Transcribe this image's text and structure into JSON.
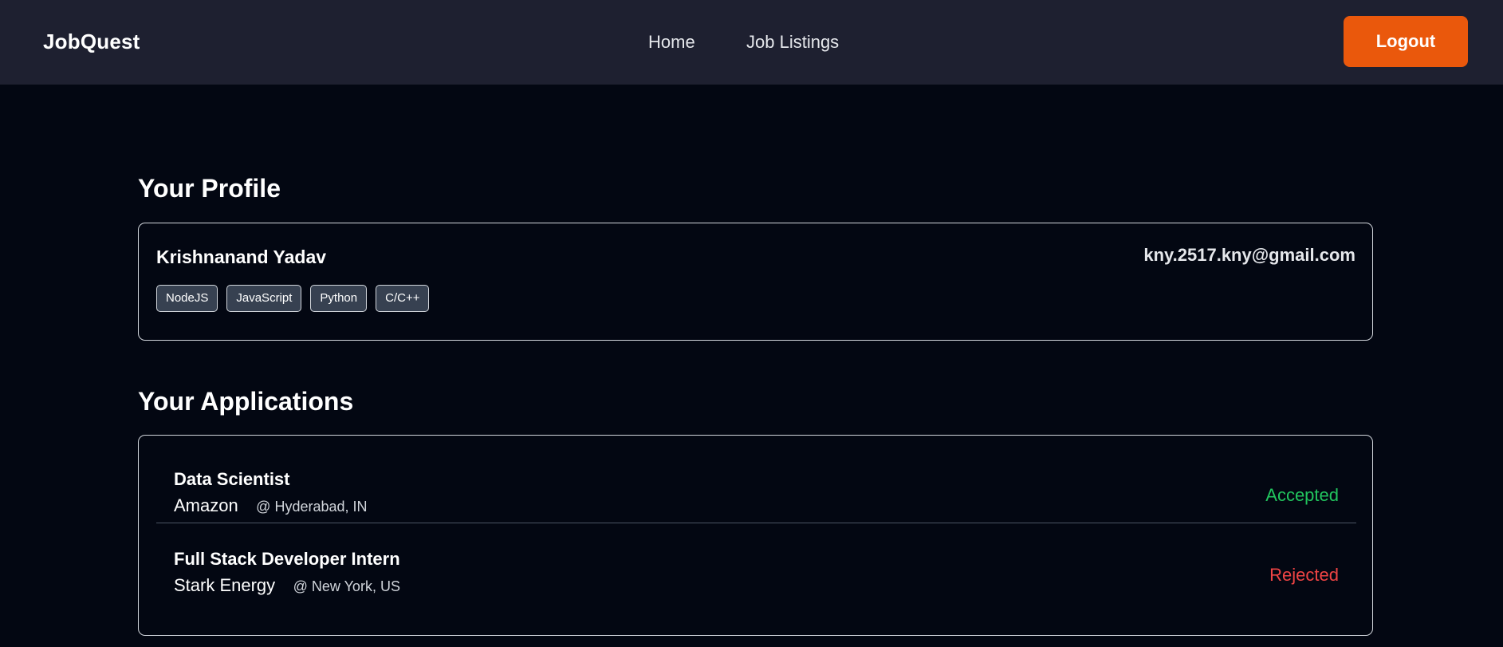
{
  "nav": {
    "brand": "JobQuest",
    "links": [
      "Home",
      "Job Listings"
    ],
    "logout_label": "Logout",
    "accent_color": "#ea580c"
  },
  "profile": {
    "section_title": "Your Profile",
    "name": "Krishnanand Yadav",
    "email": "kny.2517.kny@gmail.com",
    "skills": [
      "NodeJS",
      "JavaScript",
      "Python",
      "C/C++"
    ]
  },
  "applications": {
    "section_title": "Your Applications",
    "items": [
      {
        "title": "Data Scientist",
        "company": "Amazon",
        "location": "@ Hyderabad, IN",
        "status": "Accepted",
        "status_color": "#22c55e"
      },
      {
        "title": "Full Stack Developer Intern",
        "company": "Stark Energy",
        "location": "@ New York, US",
        "status": "Rejected",
        "status_color": "#ef4444"
      }
    ]
  }
}
